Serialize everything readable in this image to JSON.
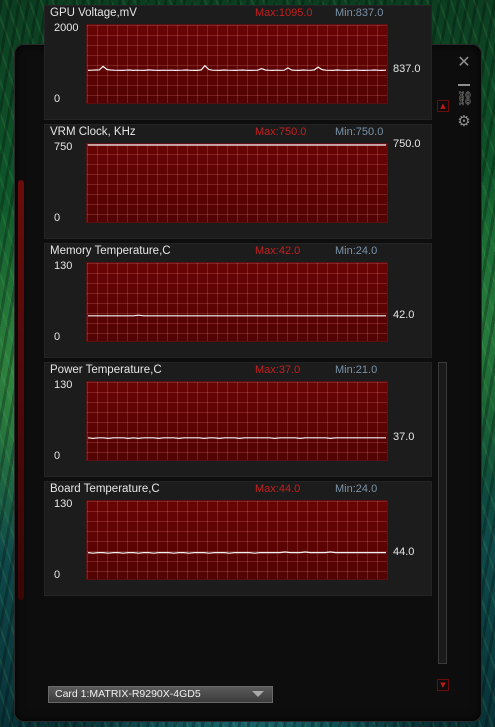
{
  "window": {
    "close_glyph": "✕",
    "link_glyph": "⛓",
    "gear_glyph": "⚙",
    "scroll_up_glyph": "▲",
    "scroll_down_glyph": "▼"
  },
  "monitors": [
    {
      "title": "GPU Voltage,mV",
      "max_text": "Max:1095.0",
      "min_text": "Min:837.0",
      "y_top": "2000",
      "y_bottom": "0",
      "current": "837.0",
      "ylim": [
        0,
        2000
      ],
      "trace": [
        837,
        840,
        845,
        850,
        940,
        860,
        845,
        840,
        838,
        837,
        840,
        845,
        837,
        842,
        838,
        837,
        850,
        843,
        838,
        837,
        842,
        838,
        840,
        837,
        838,
        842,
        845,
        838,
        837,
        836,
        850,
        960,
        860,
        842,
        838,
        837,
        845,
        840,
        838,
        837,
        842,
        845,
        838,
        837,
        838,
        840,
        880,
        846,
        838,
        837,
        842,
        838,
        840,
        900,
        845,
        838,
        837,
        845,
        840,
        838,
        850,
        920,
        860,
        842,
        838,
        837,
        845,
        840,
        838,
        837,
        842,
        845,
        838,
        837,
        838,
        840,
        845,
        838,
        837,
        842
      ]
    },
    {
      "title": "VRM Clock, KHz",
      "max_text": "Max:750.0",
      "min_text": "Min:750.0",
      "y_top": "750",
      "y_bottom": "0",
      "current": "750.0",
      "ylim": [
        0,
        750
      ],
      "trace": [
        750,
        750,
        750,
        750,
        750,
        750,
        750,
        750,
        750,
        750,
        750,
        750,
        750,
        750,
        750,
        750,
        750,
        750,
        750,
        750,
        750,
        750,
        750,
        750,
        750,
        750,
        750,
        750,
        750,
        750,
        750,
        750,
        750,
        750,
        750,
        750,
        750,
        750,
        750,
        750
      ]
    },
    {
      "title": "Memory Temperature,C",
      "max_text": "Max:42.0",
      "min_text": "Min:24.0",
      "y_top": "130",
      "y_bottom": "0",
      "current": "42.0",
      "ylim": [
        0,
        130
      ],
      "trace": [
        42,
        42,
        42,
        42,
        42,
        42,
        42,
        42,
        42,
        42,
        43,
        42,
        42,
        42,
        42,
        42,
        42,
        42,
        42,
        42,
        42,
        42,
        42,
        42,
        42,
        42,
        42,
        42,
        42,
        42,
        42,
        42,
        42,
        42,
        42,
        42,
        42,
        42,
        42,
        42,
        42,
        42,
        42,
        42,
        42,
        42,
        42,
        42,
        42,
        42,
        42,
        42,
        42,
        42,
        42,
        42,
        42,
        42,
        42,
        42
      ]
    },
    {
      "title": "Power Temperature,C",
      "max_text": "Max:37.0",
      "min_text": "Min:21.0",
      "y_top": "130",
      "y_bottom": "0",
      "current": "37.0",
      "ylim": [
        0,
        130
      ],
      "trace": [
        37,
        36,
        37,
        37,
        36,
        37,
        37,
        37,
        36,
        37,
        36,
        37,
        37,
        37,
        36,
        37,
        37,
        37,
        36,
        37,
        37,
        37,
        37,
        36,
        37,
        37,
        36,
        37,
        37,
        37,
        36,
        37,
        37,
        37,
        37,
        37,
        37,
        36,
        37,
        37,
        37,
        37,
        36,
        37,
        37,
        37,
        37,
        37,
        36,
        37,
        37,
        37,
        37,
        37,
        37,
        37,
        37,
        37,
        37,
        37
      ]
    },
    {
      "title": "Board Temperature,C",
      "max_text": "Max:44.0",
      "min_text": "Min:24.0",
      "y_top": "130",
      "y_bottom": "0",
      "current": "44.0",
      "ylim": [
        0,
        130
      ],
      "trace": [
        44,
        43,
        44,
        44,
        43,
        44,
        44,
        43,
        44,
        44,
        43,
        44,
        44,
        43,
        44,
        44,
        44,
        43,
        44,
        44,
        43,
        44,
        44,
        44,
        43,
        44,
        44,
        44,
        43,
        44,
        44,
        44,
        44,
        43,
        44,
        44,
        44,
        44,
        44,
        45,
        44,
        44,
        44,
        45,
        44,
        44,
        44,
        44,
        45,
        44,
        44,
        44,
        44,
        44,
        44,
        44,
        44,
        44,
        44,
        44
      ]
    }
  ],
  "card_selector": {
    "label": "Card 1:MATRIX-R9290X-4GD5"
  }
}
